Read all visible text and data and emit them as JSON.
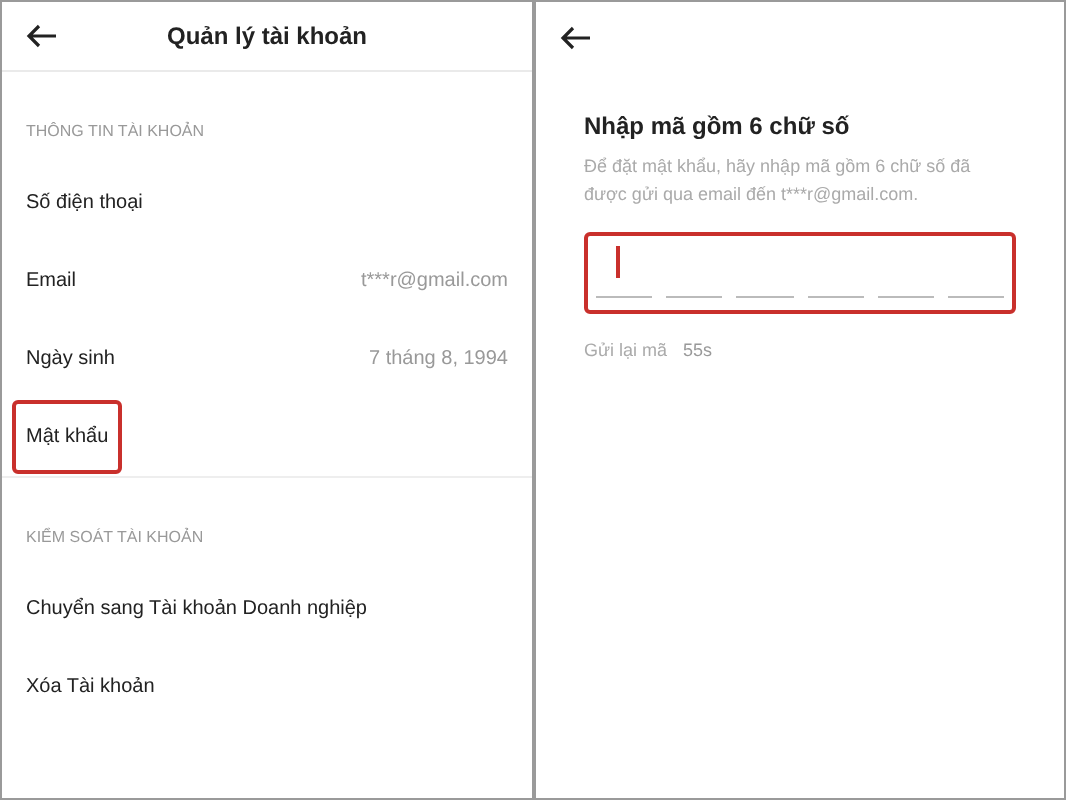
{
  "account_screen": {
    "title": "Quản lý tài khoản",
    "sections": [
      {
        "heading": "THÔNG TIN TÀI KHOẢN",
        "items": [
          {
            "label": "Số điện thoại",
            "highlighted": false
          },
          {
            "label": "Email",
            "value": "t***r@gmail.com",
            "highlighted": false
          },
          {
            "label": "Ngày sinh",
            "value": "7 tháng 8, 1994",
            "highlighted": false
          },
          {
            "label": "Mật khẩu",
            "highlighted": true
          }
        ]
      },
      {
        "heading": "KIỂM SOÁT TÀI KHOẢN",
        "items": [
          {
            "label": "Chuyển sang Tài khoản Doanh nghiệp",
            "highlighted": false
          },
          {
            "label": "Xóa Tài khoản",
            "highlighted": false
          }
        ]
      }
    ]
  },
  "code_screen": {
    "title": "Nhập mã gồm 6 chữ số",
    "description": "Để đặt mật khẩu, hãy nhập mã gồm 6 chữ số đã được gửi qua email đến t***r@gmail.com.",
    "code_field": {
      "highlighted": true,
      "slots": [
        {
          "focused": true
        },
        {
          "focused": false
        },
        {
          "focused": false
        },
        {
          "focused": false
        },
        {
          "focused": false
        },
        {
          "focused": false
        }
      ]
    },
    "resend_label": "Gửi lại mã",
    "countdown": "55s"
  }
}
